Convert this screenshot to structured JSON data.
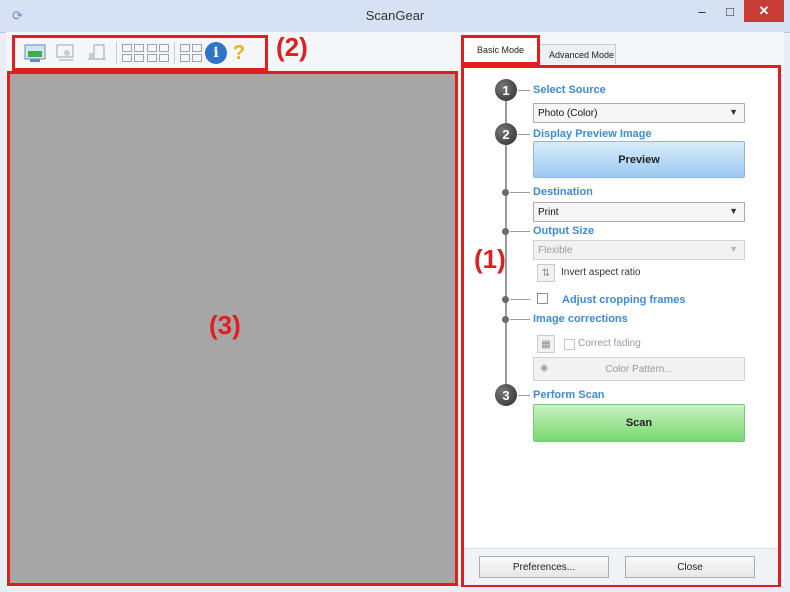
{
  "window": {
    "title": "ScanGear",
    "icon": "scanner-app-icon",
    "min_glyph": "–",
    "max_glyph": "□",
    "close_glyph": "✕"
  },
  "toolbar": {
    "icons": [
      "select-area-icon",
      "crop-icon",
      "rotate-icon",
      "grid-view-icon",
      "grid-view-alt-icon",
      "thumbnail-view-icon",
      "info-icon",
      "help-icon"
    ],
    "info_glyph": "i",
    "help_glyph": "?"
  },
  "callouts": {
    "panel": "(1)",
    "toolbar": "(2)",
    "preview": "(3)"
  },
  "tabs": [
    {
      "label": "Basic Mode",
      "active": true
    },
    {
      "label": "Advanced Mode",
      "active": false
    }
  ],
  "steps": [
    {
      "number": "1",
      "label": "Select Source"
    },
    {
      "number": "2",
      "label": "Display Preview Image"
    },
    {
      "number": "3",
      "label": "Perform Scan"
    }
  ],
  "source": {
    "value": "Photo (Color)"
  },
  "preview_button": "Preview",
  "destination": {
    "label": "Destination",
    "value": "Print"
  },
  "output_size": {
    "label": "Output Size",
    "value": "Flexible",
    "disabled": true
  },
  "invert_aspect_ratio": "Invert aspect ratio",
  "adjust_cropping": {
    "label": "Adjust cropping frames",
    "checked": false
  },
  "image_corrections": {
    "label": "Image corrections",
    "correct_fading": "Correct fading",
    "color_pattern": "Color Pattern..."
  },
  "scan_button": "Scan",
  "footer": {
    "preferences": "Preferences...",
    "close": "Close"
  },
  "colors": {
    "callout_red": "#e01e1e",
    "section_blue": "#3d8ad6",
    "preview_gray": "#a6a6a6",
    "preview_button": "#9ccaf0",
    "scan_button": "#78d86f"
  }
}
